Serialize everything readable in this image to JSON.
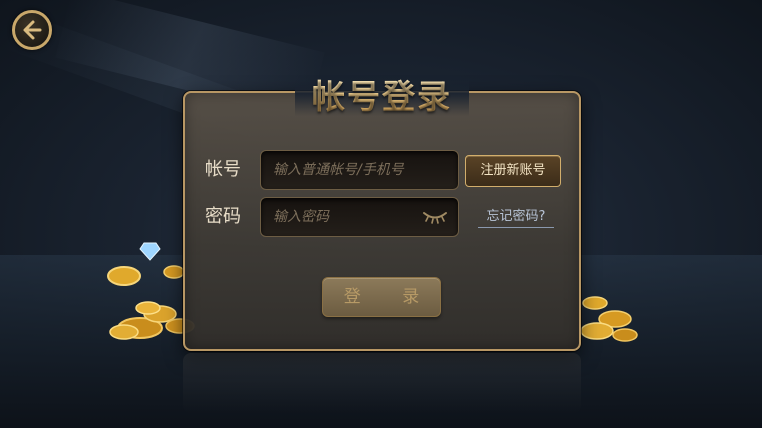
{
  "title": "帐号登录",
  "icons": {
    "back": "back-arrow-icon",
    "password_visibility": "eye-closed-icon",
    "decor_left": "gold-coins-with-diamond",
    "decor_right": "gold-coins"
  },
  "account": {
    "label": "帐号",
    "placeholder": "输入普通帐号/手机号",
    "register_label": "注册新账号"
  },
  "password": {
    "label": "密码",
    "placeholder": "输入密码",
    "forgot_label": "忘记密码?"
  },
  "login_label": "登 录",
  "colors": {
    "accent_gold": "#c9a86a",
    "title_gold": "#e7c07a",
    "background_dark": "#1a2330"
  }
}
